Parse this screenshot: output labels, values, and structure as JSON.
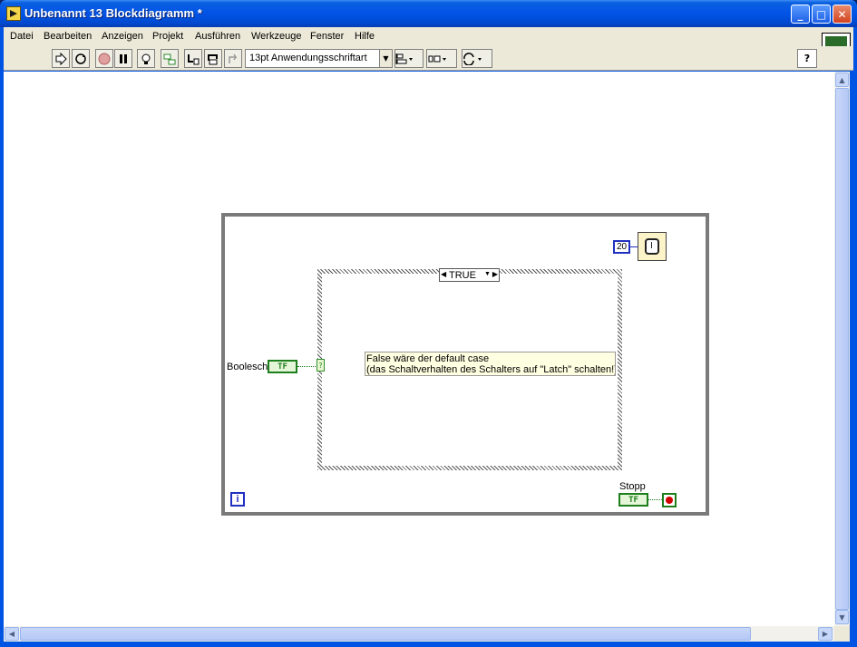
{
  "window": {
    "title": "Unbenannt 13 Blockdiagramm *",
    "minimize": "_",
    "maximize": "□",
    "close": "✕"
  },
  "menubar": {
    "items": [
      "Datei",
      "Bearbeiten",
      "Anzeigen",
      "Projekt",
      "Ausführen",
      "Werkzeuge",
      "Fenster",
      "Hilfe"
    ]
  },
  "toolbar": {
    "font_select": "13pt Anwendungsschriftart",
    "help": "?"
  },
  "diagram": {
    "case_selector": "TRUE",
    "case_terminal": "?",
    "comment_line1": "False wäre der default case",
    "comment_line2": "(das Schaltverhalten des Schalters auf \"Latch\" schalten!)",
    "bool_label": "Boolesch",
    "bool_terminal": "TF",
    "wait_constant": "20",
    "stop_label": "Stopp",
    "stop_terminal": "TF",
    "iteration_terminal": "i"
  }
}
